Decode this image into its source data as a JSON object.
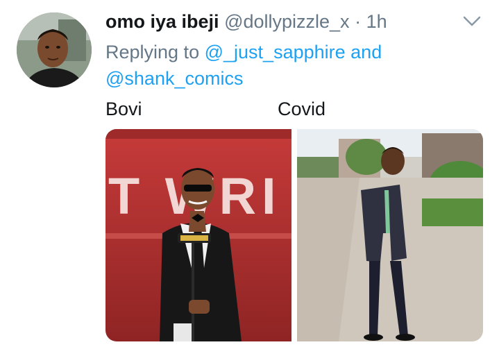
{
  "tweet": {
    "display_name": "omo iya ibeji",
    "handle": "@dollypizzle_x",
    "separator": "·",
    "time": "1h",
    "replying_prefix": "Replying to",
    "reply_user_1": "@_just_sapphire",
    "reply_and": "and",
    "reply_user_2": "@shank_comics",
    "text_left": "Bovi",
    "text_right": "Covid",
    "stage_letters": "T WRI"
  },
  "icons": {
    "caret": "chevron-down-icon",
    "avatar": "profile-avatar"
  },
  "colors": {
    "link": "#1da1f2",
    "muted": "#657786",
    "text": "#14171a"
  }
}
